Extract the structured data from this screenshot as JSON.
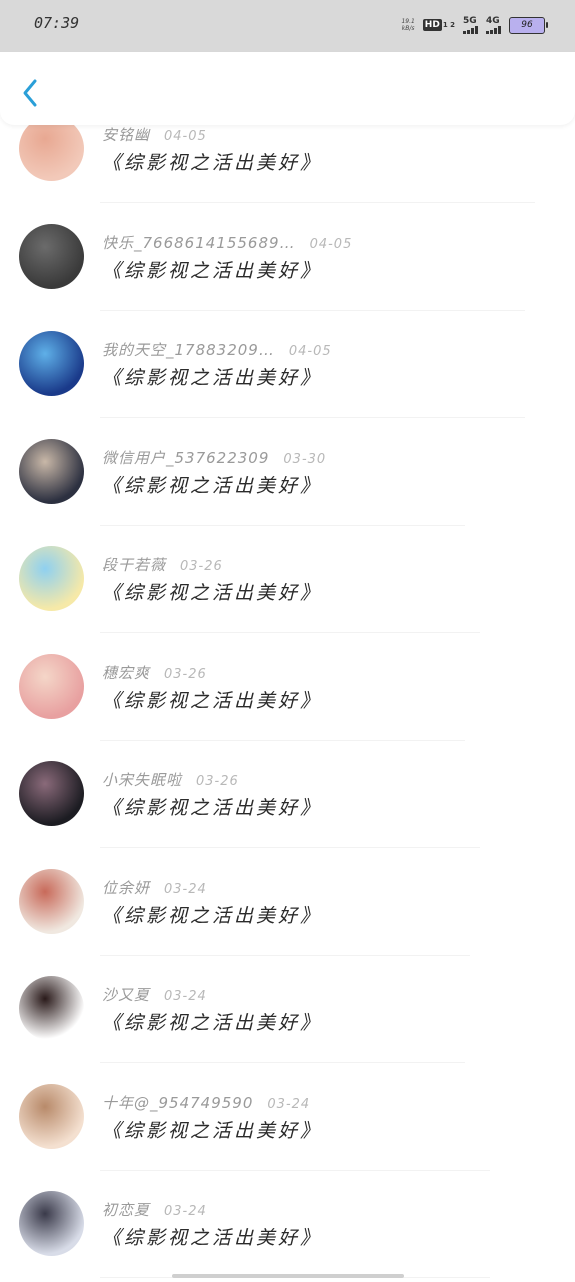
{
  "status_bar": {
    "time": "07:39",
    "speed_value": "19.1",
    "speed_unit": "kB/s",
    "hd_label": "HD",
    "hd_nums": "1 2",
    "net1": "5G",
    "net2": "4G",
    "battery": "96"
  },
  "comments": [
    {
      "name": "安铭幽",
      "date": "04-05",
      "title": "《综影视之活出美好》",
      "avatar_colors": [
        "#f2c9b9",
        "#e8a892"
      ]
    },
    {
      "name": "快乐_7668614155689…",
      "date": "04-05",
      "title": "《综影视之活出美好》",
      "avatar_colors": [
        "#3a3a3a",
        "#6b6b6b"
      ]
    },
    {
      "name": "我的天空_17883209…",
      "date": "04-05",
      "title": "《综影视之活出美好》",
      "avatar_colors": [
        "#1a3a8a",
        "#5fb0e8"
      ]
    },
    {
      "name": "微信用户_537622309",
      "date": "03-30",
      "title": "《综影视之活出美好》",
      "avatar_colors": [
        "#2c3040",
        "#c9b8a8"
      ]
    },
    {
      "name": "段干若薇",
      "date": "03-26",
      "title": "《综影视之活出美好》",
      "avatar_colors": [
        "#f6e9a8",
        "#8fd0f0"
      ]
    },
    {
      "name": "穗宏爽",
      "date": "03-26",
      "title": "《综影视之活出美好》",
      "avatar_colors": [
        "#e8a0a0",
        "#f4d6c8"
      ]
    },
    {
      "name": "小宋失眠啦",
      "date": "03-26",
      "title": "《综影视之活出美好》",
      "avatar_colors": [
        "#1c1c22",
        "#8a6a7a"
      ]
    },
    {
      "name": "位余妍",
      "date": "03-24",
      "title": "《综影视之活出美好》",
      "avatar_colors": [
        "#f0e8e0",
        "#c86a5a"
      ]
    },
    {
      "name": "沙又夏",
      "date": "03-24",
      "title": "《综影视之活出美好》",
      "avatar_colors": [
        "#ffffff",
        "#2a1a1a"
      ]
    },
    {
      "name": "十年@_954749590",
      "date": "03-24",
      "title": "《综影视之活出美好》",
      "avatar_colors": [
        "#f4e0d0",
        "#b88a6a"
      ]
    },
    {
      "name": "初恋夏",
      "date": "03-24",
      "title": "《综影视之活出美好》",
      "avatar_colors": [
        "#d8dce8",
        "#3a3a4a"
      ]
    }
  ]
}
